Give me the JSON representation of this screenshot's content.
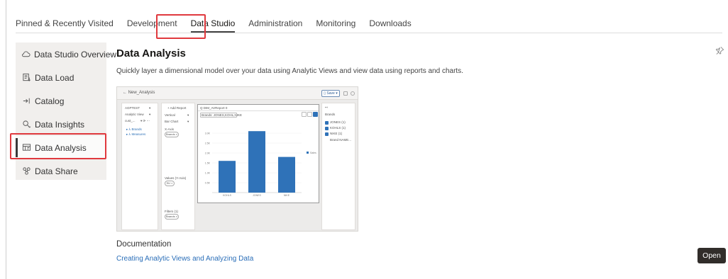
{
  "topnav": {
    "tabs": [
      {
        "label": "Pinned & Recently Visited"
      },
      {
        "label": "Development"
      },
      {
        "label": "Data Studio"
      },
      {
        "label": "Administration"
      },
      {
        "label": "Monitoring"
      },
      {
        "label": "Downloads"
      }
    ],
    "active_tab": "Data Studio"
  },
  "sidebar": {
    "items": [
      {
        "label": "Data Studio Overview",
        "icon": "cloud-icon"
      },
      {
        "label": "Data Load",
        "icon": "data-load-icon"
      },
      {
        "label": "Catalog",
        "icon": "catalog-icon"
      },
      {
        "label": "Data Insights",
        "icon": "insights-icon"
      },
      {
        "label": "Data Analysis",
        "icon": "analysis-icon"
      },
      {
        "label": "Data Share",
        "icon": "share-icon"
      }
    ],
    "active_item": "Data Analysis"
  },
  "main": {
    "title": "Data Analysis",
    "description": "Quickly layer a dimensional model over your data using Analytic Views and view data using reports and charts.",
    "documentation_label": "Documentation",
    "documentation_link": "Creating Analytic Views and Analyzing Data",
    "open_label": "Open"
  },
  "preview": {
    "back_label": "← New_Analysis",
    "save_label": "▯ Save ▾",
    "add_report": "+ Add Report",
    "left_panel": [
      "AGPTEST",
      "Analytic View",
      "cust_...",
      "▸ ⅄ Brands",
      "▸ ⅄ Measures"
    ],
    "report_title": "Q DIM_AVReport 0",
    "filter_text": "Brands: JONES,KOHL,NIKE",
    "chart_type": "Vertical",
    "chart_kind": "Bar Chart",
    "x_axis_label": "X-Axis",
    "values_label": "Values (Y-Axis)",
    "filters_label": "Filters (1)",
    "pill_brands": "Brands ×",
    "pill_sales": "SU ×",
    "right_panel": [
      "Brands",
      "JONES (1)",
      "KOHLS (1)",
      "NIKE (1)",
      "Brand NAME..."
    ],
    "legend": "Sales",
    "colors": {
      "bar": "#2f72b8",
      "accent": "#e0393e"
    }
  },
  "chart_data": {
    "type": "bar",
    "categories": [
      "KOHLS",
      "JONES",
      "NIKE"
    ],
    "series": [
      {
        "name": "Sales",
        "values": [
          1.6,
          3.1,
          1.8
        ]
      }
    ],
    "ylim": [
      0,
      3.5
    ],
    "yticks": [
      0.5,
      1.0,
      1.5,
      2.0,
      2.5,
      3.0
    ]
  }
}
